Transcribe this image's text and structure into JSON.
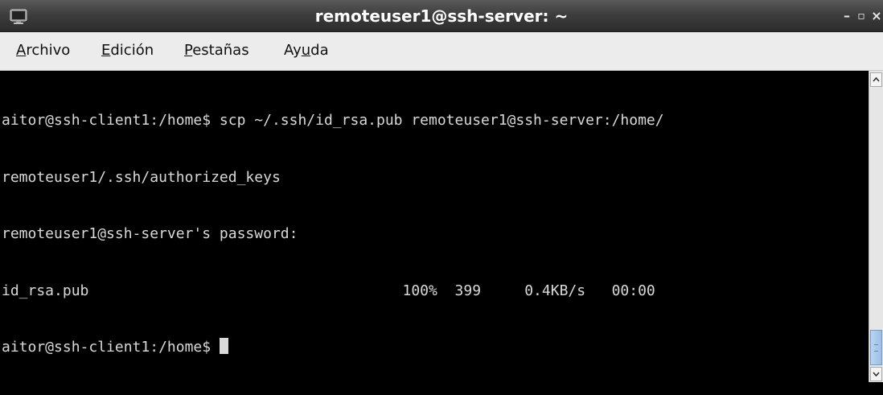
{
  "window": {
    "title": "remoteuser1@ssh-server: ~",
    "controls": {
      "minimize": "–",
      "maximize": "▫",
      "close": "×"
    }
  },
  "menubar": {
    "items": [
      {
        "mnemonic": "A",
        "rest": "rchivo"
      },
      {
        "mnemonic": "E",
        "rest": "dición"
      },
      {
        "mnemonic": "P",
        "rest": "estañas"
      },
      {
        "pre": "Ay",
        "mnemonic": "u",
        "rest": "da"
      }
    ]
  },
  "terminal": {
    "lines": [
      "aitor@ssh-client1:/home$ scp ~/.ssh/id_rsa.pub remoteuser1@ssh-server:/home/",
      "remoteuser1/.ssh/authorized_keys",
      "remoteuser1@ssh-server's password:",
      "id_rsa.pub                                    100%  399     0.4KB/s   00:00"
    ],
    "prompt": "aitor@ssh-client1:/home$ "
  },
  "scrollbar": {
    "up_icon": "chevron-up-icon",
    "down_icon": "chevron-down-icon",
    "position": 1.0
  },
  "colors": {
    "terminal_bg": "#000000",
    "terminal_fg": "#d9d9d9",
    "menubar_bg": "#ececec",
    "titlebar_bg": "#3e3e3e",
    "scroll_thumb": "#9cc0e6"
  }
}
